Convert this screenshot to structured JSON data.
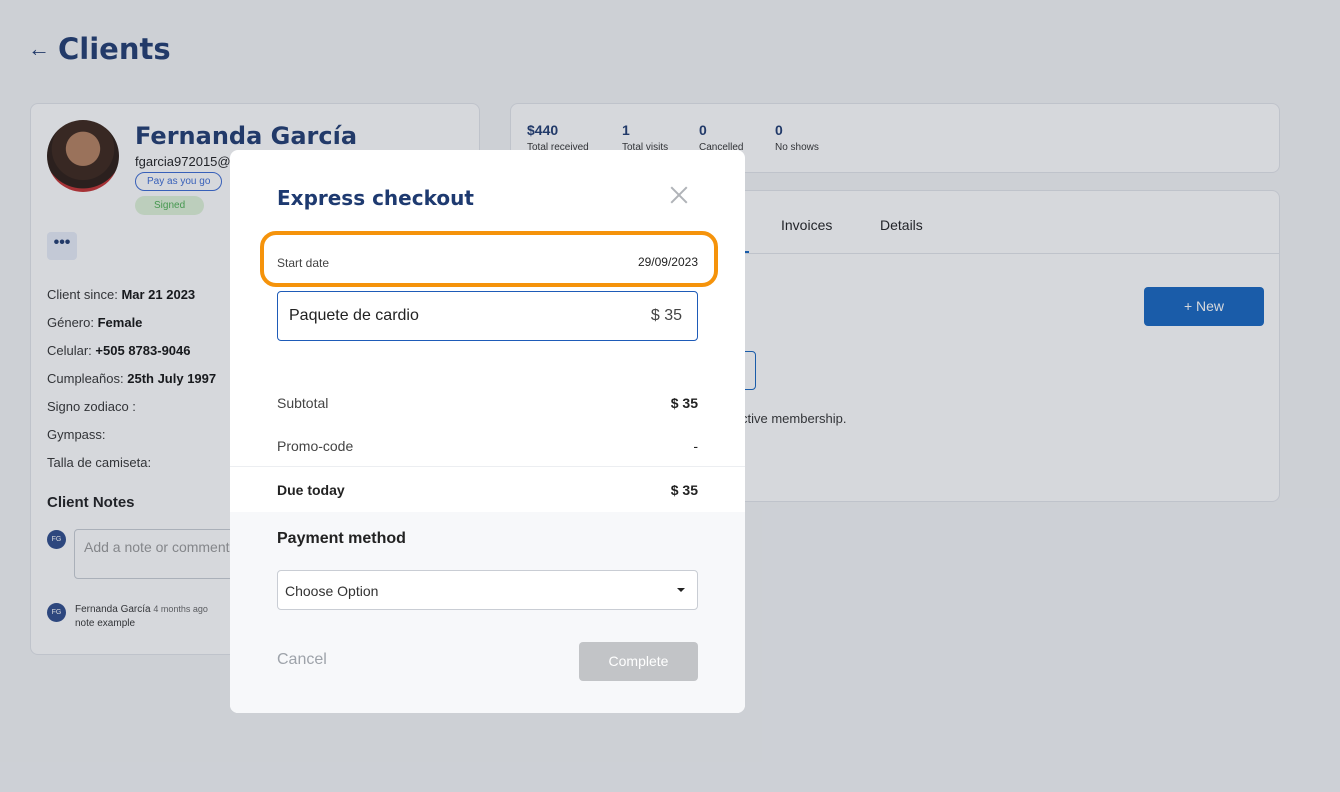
{
  "page": {
    "title": "Clients",
    "back_icon": "arrow-left-icon"
  },
  "profile": {
    "name": "Fernanda García",
    "email": "fgarcia972015@",
    "plan_badge": "Pay as you go",
    "status_badge": "Signed",
    "more_icon": "•••",
    "info": [
      {
        "label": "Client since:",
        "value": "Mar 21 2023"
      },
      {
        "label": "Género:",
        "value": "Female"
      },
      {
        "label": "Celular:",
        "value": "+505 8783-9046"
      },
      {
        "label": "Cumpleaños:",
        "value": "25th July 1997"
      },
      {
        "label": "Signo zodiaco :",
        "value": ""
      },
      {
        "label": "Gympass:",
        "value": ""
      },
      {
        "label": "Talla de camiseta:",
        "value": ""
      }
    ],
    "notes": {
      "title": "Client Notes",
      "avatar_initials": "FG",
      "input_placeholder": "Add a note or comment",
      "entries": [
        {
          "initials": "FG",
          "author": "Fernanda García",
          "time": "4 months ago",
          "text": "note example"
        }
      ]
    }
  },
  "stats": [
    {
      "value": "$440",
      "label": "Total received"
    },
    {
      "value": "1",
      "label": "Total visits"
    },
    {
      "value": "0",
      "label": "Cancelled"
    },
    {
      "value": "0",
      "label": "No shows"
    }
  ],
  "tabs": {
    "items": [
      "Invoices",
      "Details"
    ],
    "new_button": "+ New",
    "membership_text": "ctive membership."
  },
  "modal": {
    "title": "Express checkout",
    "start_date": {
      "label": "Start date",
      "value": "29/09/2023"
    },
    "item": {
      "name": "Paquete de cardio",
      "price": "$ 35"
    },
    "subtotal": {
      "label": "Subtotal",
      "value": "$ 35"
    },
    "promo": {
      "label": "Promo-code",
      "value": "-"
    },
    "due": {
      "label": "Due today",
      "value": "$ 35"
    },
    "payment": {
      "title": "Payment method",
      "selected": "Choose Option"
    },
    "cancel_label": "Cancel",
    "complete_label": "Complete"
  },
  "colors": {
    "brand": "#1e3a70",
    "primary": "#1565c0",
    "highlight": "#f5930b",
    "disabled": "#c2c4c7"
  }
}
